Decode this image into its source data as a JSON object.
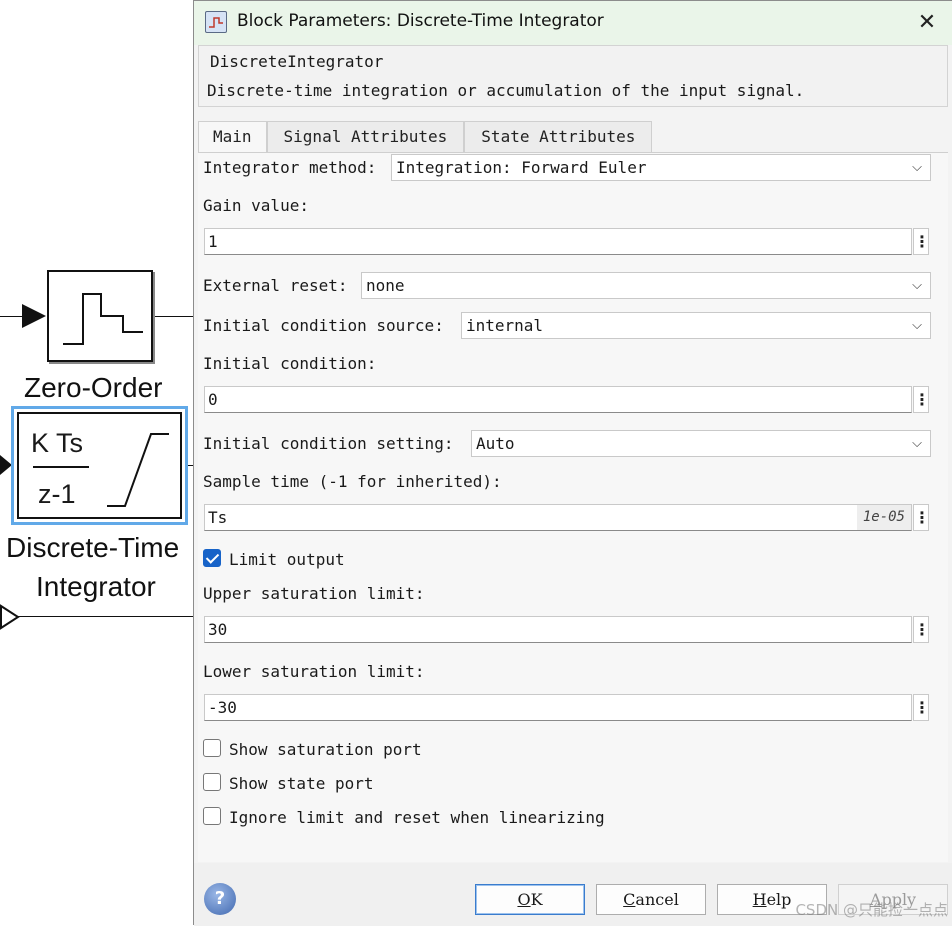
{
  "canvas": {
    "zoh_label": "Zero-Order",
    "dti_num": "K Ts",
    "dti_den": "z-1",
    "dti_label_line1": "Discrete-Time",
    "dti_label_line2": "Integrator"
  },
  "dialog": {
    "title": "Block Parameters: Discrete-Time Integrator",
    "close_glyph": "✕",
    "block_type": "DiscreteIntegrator",
    "description": "Discrete-time integration or accumulation of the input signal.",
    "tabs": [
      {
        "label": "Main",
        "active": true
      },
      {
        "label": "Signal Attributes",
        "active": false
      },
      {
        "label": "State Attributes",
        "active": false
      }
    ],
    "params": {
      "integrator_method_label": "Integrator method:",
      "integrator_method_value": "Integration: Forward Euler",
      "gain_label": "Gain value:",
      "gain_value": "1",
      "external_reset_label": "External reset:",
      "external_reset_value": "none",
      "ic_source_label": "Initial condition source:",
      "ic_source_value": "internal",
      "ic_label": "Initial condition:",
      "ic_value": "0",
      "ic_setting_label": "Initial condition setting:",
      "ic_setting_value": "Auto",
      "sample_time_label": "Sample time (-1 for inherited):",
      "sample_time_value": "Ts",
      "sample_time_hint": "1e-05",
      "limit_output_label": "Limit output",
      "limit_output_checked": true,
      "upper_label": "Upper saturation limit:",
      "upper_value": "30",
      "lower_label": "Lower saturation limit:",
      "lower_value": "-30",
      "show_sat_port_label": "Show saturation port",
      "show_state_port_label": "Show state port",
      "ignore_limit_label": "Ignore limit and reset when linearizing"
    },
    "buttons": {
      "ok_rest": "K",
      "ok_mnemonic": "O",
      "cancel_mnemonic": "C",
      "cancel_rest": "ancel",
      "help_mnemonic": "H",
      "help_rest": "elp",
      "apply_mnemonic": "A",
      "apply_rest": "pply"
    },
    "help_icon_glyph": "?",
    "kebab_glyph": "⋮",
    "chevron_glyph": "⌵"
  },
  "watermark": "CSDN @只能捡一点点"
}
